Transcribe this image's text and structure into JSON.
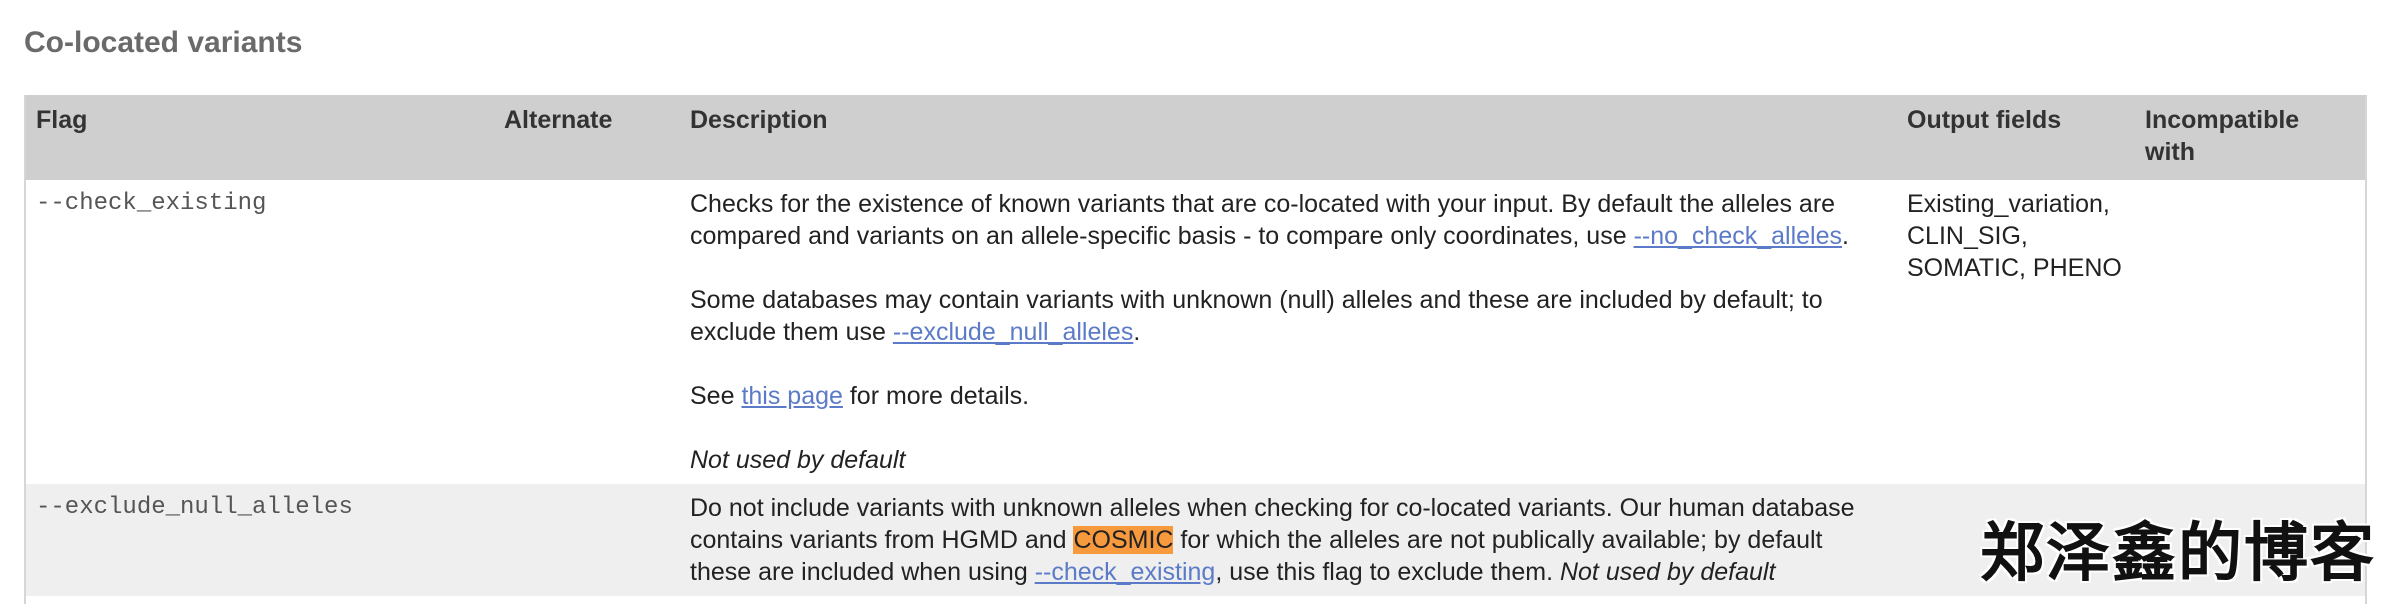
{
  "section": {
    "title": "Co-located variants"
  },
  "table": {
    "headers": {
      "flag": "Flag",
      "alternate": "Alternate",
      "description": "Description",
      "output_fields": "Output fields",
      "incompatible_line1": "Incompatible",
      "incompatible_line2": "with"
    },
    "rows": [
      {
        "flag": "--check_existing",
        "alternate": "",
        "desc": {
          "p1_a": "Checks for the existence of known variants that are co-located with your input. By default the alleles are compared and variants on an allele-specific basis - to compare only coordinates, use ",
          "p1_link": "--no_check_alleles",
          "p1_b": ".",
          "p2_a": "Some databases may contain variants with unknown (null) alleles and these are included by default; to exclude them use ",
          "p2_link": "--exclude_null_alleles",
          "p2_b": ".",
          "p3_a": "See ",
          "p3_link": "this page",
          "p3_b": " for more details.",
          "p4": "Not used by default"
        },
        "output_fields": {
          "line1": "Existing_variation,",
          "line2": "CLIN_SIG,",
          "line3": "SOMATIC, PHENO"
        },
        "incompatible": ""
      },
      {
        "flag": "--exclude_null_alleles",
        "alternate": "",
        "desc": {
          "a": "Do not include variants with unknown alleles when checking for co-located variants. Our human database contains variants from HGMD and ",
          "highlight": "COSMIC",
          "b": " for which the alleles are not publically available; by default these are included when using ",
          "link": "--check_existing",
          "c": ", use this flag to exclude them. ",
          "d": "Not used by default"
        },
        "output_fields": "",
        "incompatible": ""
      }
    ]
  },
  "watermark": "郑泽鑫的博客",
  "colors": {
    "header_bg": "#cfcfcf",
    "link": "#5b7bc8",
    "highlight": "#f79a3e",
    "alt_row": "#efefef"
  }
}
